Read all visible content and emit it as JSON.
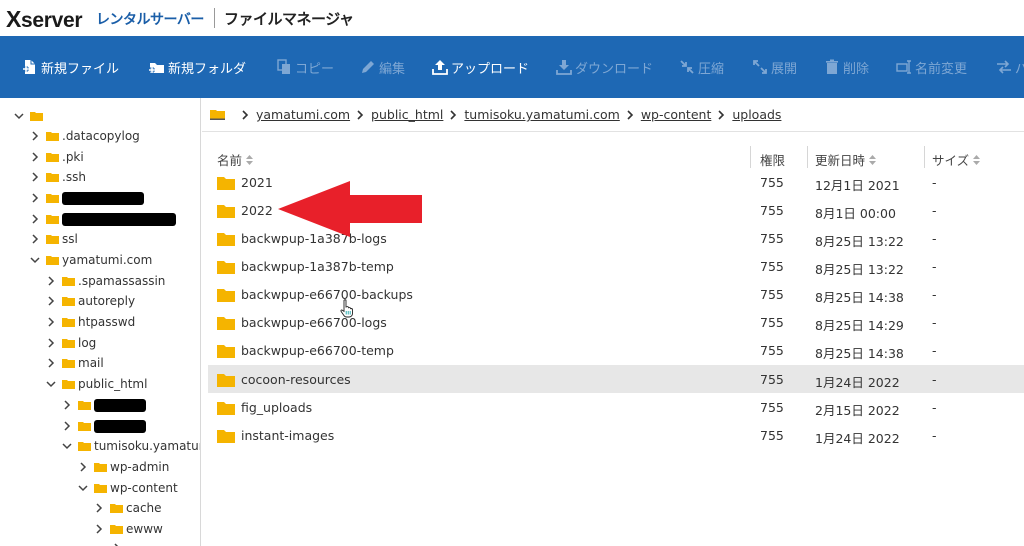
{
  "header": {
    "logo_x": "X",
    "logo_rest": "server",
    "logo_sub": "レンタルサーバー",
    "app_title": "ファイルマネージャ"
  },
  "toolbar": {
    "new_file": "新規ファイル",
    "new_folder": "新規フォルダ",
    "copy": "コピー",
    "edit": "編集",
    "upload": "アップロード",
    "download": "ダウンロード",
    "compress": "圧縮",
    "extract": "展開",
    "delete": "削除",
    "rename": "名前変更",
    "more": "パ"
  },
  "tree": [
    {
      "label": ".datacopylog"
    },
    {
      "label": ".pki"
    },
    {
      "label": ".ssh"
    },
    {
      "label": ""
    },
    {
      "label": ""
    },
    {
      "label": "ssl"
    },
    {
      "label": "yamatumi.com"
    },
    {
      "label": ".spamassassin"
    },
    {
      "label": "autoreply"
    },
    {
      "label": "htpasswd"
    },
    {
      "label": "log"
    },
    {
      "label": "mail"
    },
    {
      "label": "public_html"
    },
    {
      "label": ""
    },
    {
      "label": ""
    },
    {
      "label": "tumisoku.yamatumi."
    },
    {
      "label": "wp-admin"
    },
    {
      "label": "wp-content"
    },
    {
      "label": "cache"
    },
    {
      "label": "ewww"
    }
  ],
  "breadcrumb": [
    "yamatumi.com",
    "public_html",
    "tumisoku.yamatumi.com",
    "wp-content",
    "uploads"
  ],
  "columns": {
    "name": "名前",
    "perm": "権限",
    "date": "更新日時",
    "size": "サイズ"
  },
  "files": [
    {
      "name": "2021",
      "perm": "755",
      "date": "12月1日 2021",
      "size": "-"
    },
    {
      "name": "2022",
      "perm": "755",
      "date": "8月1日 00:00",
      "size": "-"
    },
    {
      "name": "backwpup-1a387b-logs",
      "perm": "755",
      "date": "8月25日 13:22",
      "size": "-"
    },
    {
      "name": "backwpup-1a387b-temp",
      "perm": "755",
      "date": "8月25日 13:22",
      "size": "-"
    },
    {
      "name": "backwpup-e66700-backups",
      "perm": "755",
      "date": "8月25日 14:38",
      "size": "-"
    },
    {
      "name": "backwpup-e66700-logs",
      "perm": "755",
      "date": "8月25日 14:29",
      "size": "-"
    },
    {
      "name": "backwpup-e66700-temp",
      "perm": "755",
      "date": "8月25日 14:38",
      "size": "-"
    },
    {
      "name": "cocoon-resources",
      "perm": "755",
      "date": "1月24日 2022",
      "size": "-"
    },
    {
      "name": "fig_uploads",
      "perm": "755",
      "date": "2月15日 2022",
      "size": "-"
    },
    {
      "name": "instant-images",
      "perm": "755",
      "date": "1月24日 2022",
      "size": "-"
    }
  ],
  "colors": {
    "toolbar": "#1e68b4",
    "folder": "#f5b400",
    "arrow": "#e8202a",
    "selected_row": "#e7e7e7",
    "brand_blue": "#1a5ea8"
  }
}
